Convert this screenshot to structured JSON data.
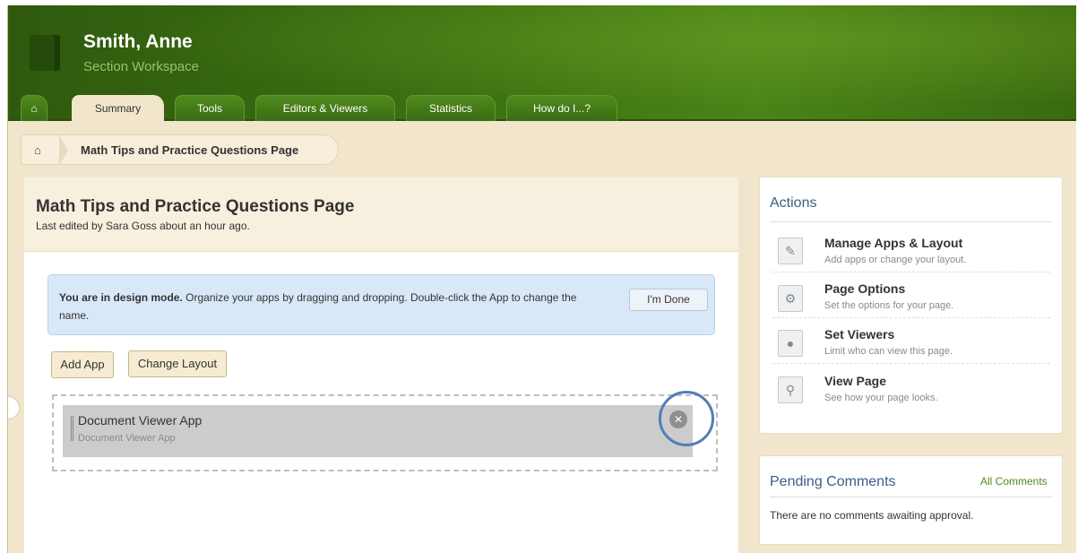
{
  "header": {
    "user_name": "Smith, Anne",
    "workspace": "Section Workspace",
    "tabs": [
      {
        "label": "Summary"
      },
      {
        "label": "Tools"
      },
      {
        "label": "Editors & Viewers"
      },
      {
        "label": "Statistics"
      },
      {
        "label": "How do I...?"
      }
    ]
  },
  "breadcrumb": {
    "current": "Math Tips and Practice Questions Page"
  },
  "main": {
    "title": "Math Tips and Practice Questions Page",
    "last_edited": "Last edited by Sara Goss about an hour ago.",
    "notice": {
      "bold": "You are in design mode.",
      "text": " Organize your apps by dragging and dropping. Double-click the App to change the name.",
      "done_label": "I'm Done"
    },
    "add_app_label": "Add App",
    "change_layout_label": "Change Layout",
    "app": {
      "title": "Document Viewer App",
      "subtitle": "Document Viewer App"
    }
  },
  "actions": {
    "title": "Actions",
    "items": [
      {
        "title": "Manage Apps & Layout",
        "desc": "Add apps or change your layout.",
        "icon": "pencil-icon"
      },
      {
        "title": "Page Options",
        "desc": "Set the options for your page.",
        "icon": "gear-page-icon"
      },
      {
        "title": "Set Viewers",
        "desc": "Limit who can view this page.",
        "icon": "people-icon"
      },
      {
        "title": "View Page",
        "desc": "See how your page looks.",
        "icon": "magnifier-icon"
      }
    ]
  },
  "comments": {
    "title": "Pending Comments",
    "all_label": "All Comments",
    "empty_text": "There are no comments awaiting approval."
  },
  "colors": {
    "header_green": "#3d7212",
    "page_bg": "#f1e6cc",
    "notice_blue": "#d9e8f8",
    "link_green": "#4e8a1c",
    "highlight_ring": "#4f7fb8"
  }
}
